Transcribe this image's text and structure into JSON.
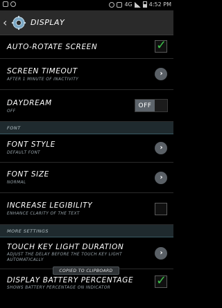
{
  "status_bar": {
    "network": "4G",
    "time": "4:52 PM"
  },
  "header": {
    "title": "Display",
    "icon": "gear-icon"
  },
  "rows": [
    {
      "label": "Auto-rotate screen",
      "sub": "",
      "control": "checkbox",
      "checked": true
    },
    {
      "label": "Screen timeout",
      "sub": "After 1 minute of inactivity",
      "control": "chevron"
    },
    {
      "label": "Daydream",
      "sub": "Off",
      "control": "toggle",
      "toggle_text": "OFF"
    }
  ],
  "section_font": "Font",
  "font_rows": [
    {
      "label": "Font style",
      "sub": "Default font",
      "control": "chevron"
    },
    {
      "label": "Font size",
      "sub": "Normal",
      "control": "chevron"
    },
    {
      "label": "Increase legibility",
      "sub": "Enhance clarity of the text",
      "control": "checkbox",
      "checked": false
    }
  ],
  "section_more": "More settings",
  "more_rows": [
    {
      "label": "Touch key light duration",
      "sub": "Adjust the delay before the touch key light",
      "sub2": "automatically",
      "control": "chevron"
    },
    {
      "label": "Display battery percentage",
      "sub": "Shows battery percentage on indicator",
      "control": "checkbox",
      "checked": true
    }
  ],
  "toast": "Copied to clipboard",
  "colors": {
    "accent_green": "#3ec14a",
    "section_bg": "#1f2a2e",
    "toggle_off": "#5d646b"
  }
}
